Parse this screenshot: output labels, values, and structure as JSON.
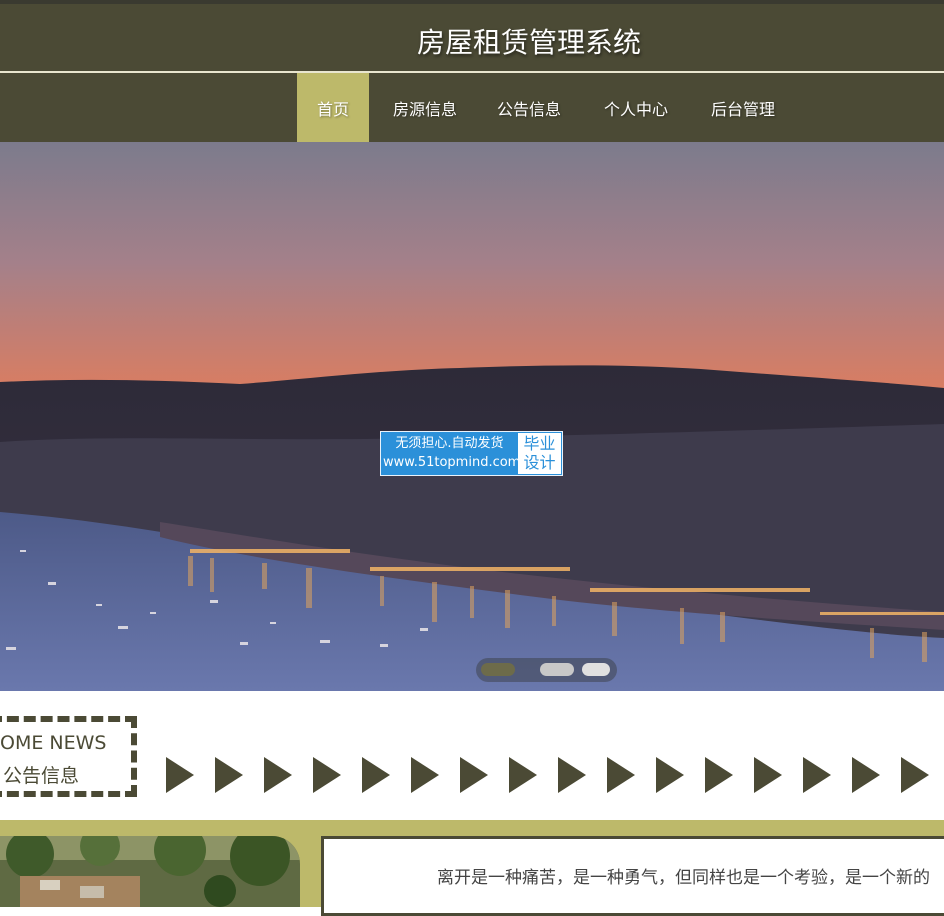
{
  "header": {
    "title": "房屋租赁管理系统"
  },
  "nav": {
    "items": [
      {
        "label": "首页",
        "active": true
      },
      {
        "label": "房源信息",
        "active": false
      },
      {
        "label": "公告信息",
        "active": false
      },
      {
        "label": "个人中心",
        "active": false
      },
      {
        "label": "后台管理",
        "active": false
      }
    ]
  },
  "watermark": {
    "line1": "无须担心.自动发货",
    "line2": "www.51topmind.com",
    "right_line1": "毕业",
    "right_line2": "设计"
  },
  "carousel": {
    "slide_count": 3,
    "active_index": 0
  },
  "news": {
    "title_en": "OME NEWS",
    "title_cn": "公告信息",
    "arrow_icon": "play-arrow-icon"
  },
  "notice": {
    "text": "离开是一种痛苦，是一种勇气，但同样也是一个考验，是一个新的"
  },
  "colors": {
    "primary": "#4b4a35",
    "accent": "#bdb96a",
    "watermark_blue": "#2b90d9"
  }
}
